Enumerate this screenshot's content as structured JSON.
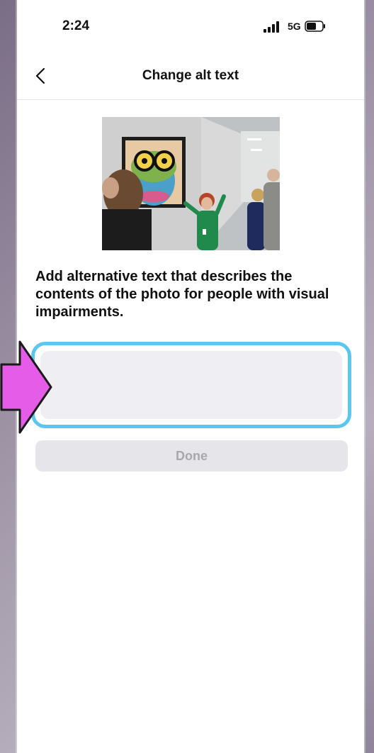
{
  "status_bar": {
    "time": "2:24",
    "network": "5G"
  },
  "header": {
    "title": "Change alt text"
  },
  "photo": {
    "alt": "Group of people in a hallway viewing a framed frog artwork"
  },
  "content": {
    "description": "Add alternative text that describes the contents of the photo for people with visual impairments."
  },
  "alt_field": {
    "value": "",
    "placeholder": ""
  },
  "actions": {
    "done_label": "Done"
  },
  "colors": {
    "highlight": "#5bc7f0",
    "arrow": "#e45ce7",
    "done_bg": "#e6e6ea",
    "done_text": "#a7a7ad"
  }
}
